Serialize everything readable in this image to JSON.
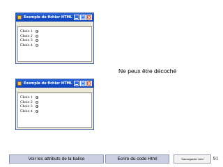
{
  "window1": {
    "title": "Exemple de fichier HTML - Jeanhon...",
    "choices": [
      {
        "label": "Choix 1",
        "checked": true
      },
      {
        "label": "Choix 2",
        "checked": false
      },
      {
        "label": "Choix 3",
        "checked": false
      },
      {
        "label": "Choix 4",
        "checked": false
      }
    ]
  },
  "window2": {
    "title": "Exemple de fichier HTML - Jeanhon...",
    "choices": [
      {
        "label": "Choix 1",
        "checked": true
      },
      {
        "label": "Choix 2",
        "checked": false
      },
      {
        "label": "Choix 3",
        "checked": true
      },
      {
        "label": "Choix 4",
        "checked": true
      }
    ]
  },
  "note": "Ne peux être décoché",
  "footer": {
    "attributes_button": "Voir les attributs de la balise",
    "write_code_button": "Ecrire du code Html",
    "save_button": "Sauvegarder html",
    "page_number": "91"
  },
  "colors": {
    "titlebar": "#0a3fb8",
    "window_frame": "#ece9d8",
    "footer_button": "#c9cfe0",
    "radio_checked": "#2a7a2a"
  }
}
